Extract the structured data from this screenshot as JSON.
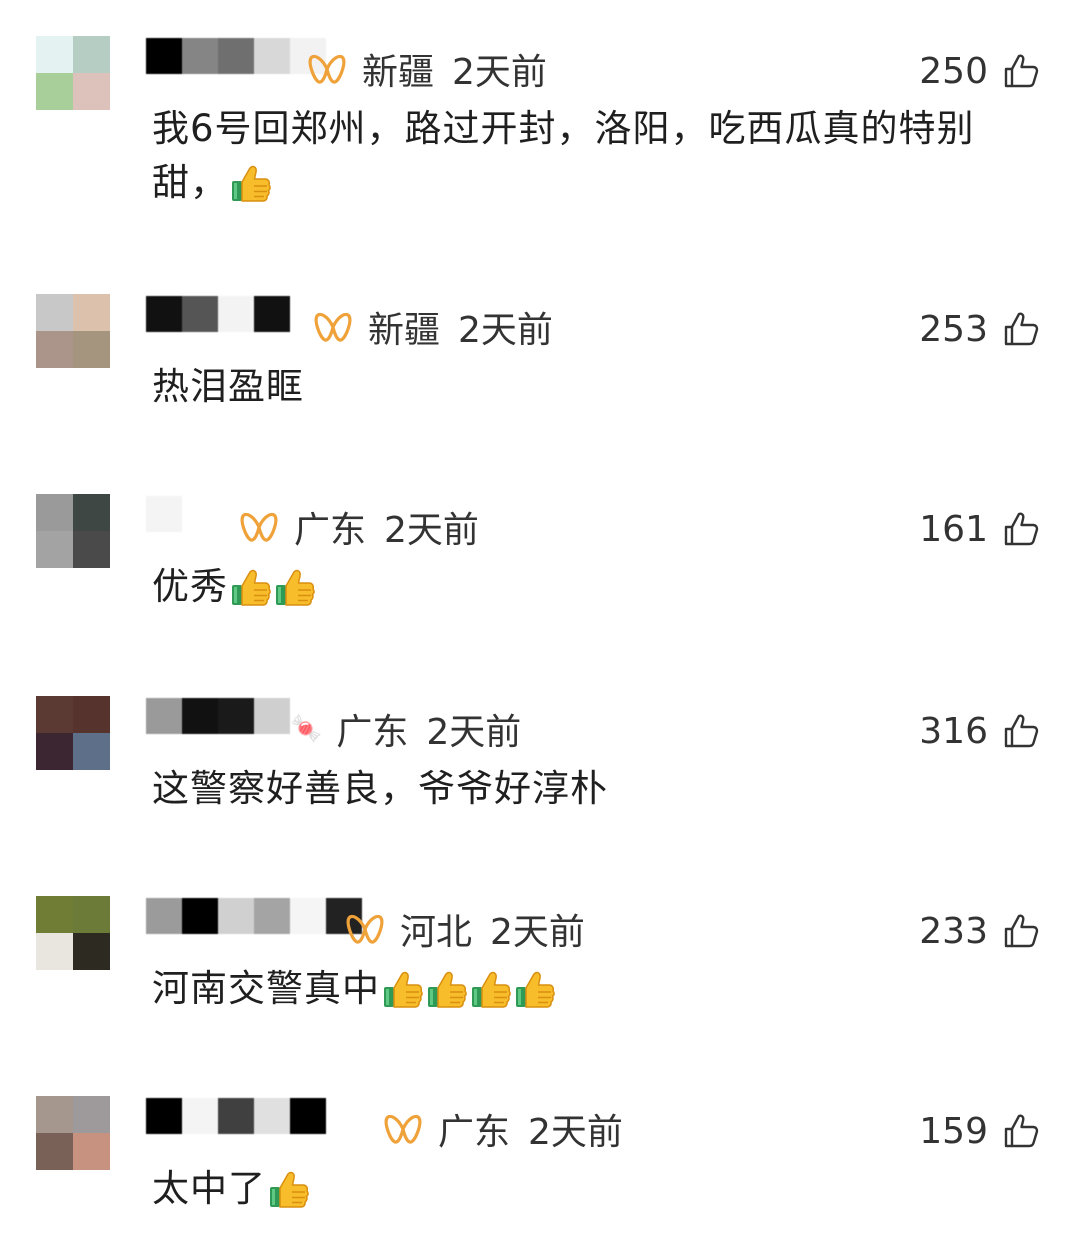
{
  "comments": [
    {
      "location": "新疆",
      "time": "2天前",
      "likes": "250",
      "text": "我6号回郑州，路过开封，洛阳，吃西瓜真的特别甜，",
      "emoji_count": 1,
      "badge": "gold-badge-icon",
      "avatar": [
        "#e4f2f2",
        "#b6cdc4",
        "#a8cf9a",
        "#dcc2bb"
      ],
      "name_blocks": [
        "#000000",
        "#858585",
        "#6f6f6f",
        "#d8d8d8",
        "#f2f2f2"
      ]
    },
    {
      "location": "新疆",
      "time": "2天前",
      "likes": "253",
      "text": "热泪盈眶",
      "emoji_count": 0,
      "badge": "gold-badge-icon",
      "avatar": [
        "#c8c8c8",
        "#dcc2ad",
        "#ab958b",
        "#a5957f"
      ],
      "name_blocks": [
        "#111111",
        "#555555",
        "#f3f3f3",
        "#111111"
      ]
    },
    {
      "location": "广东",
      "time": "2天前",
      "likes": "161",
      "text": "优秀",
      "emoji_count": 2,
      "badge": "gold-badge-icon",
      "avatar": [
        "#9a9a9a",
        "#3f4744",
        "#a3a3a3",
        "#4a4a4a"
      ],
      "name_blocks": [
        "#f4f4f4"
      ]
    },
    {
      "location": "广东",
      "time": "2天前",
      "likes": "316",
      "text": "这警察好善良，爷爷好淳朴",
      "emoji_count": 0,
      "badge": "candy-icon",
      "avatar": [
        "#5a3a32",
        "#56332c",
        "#3b2631",
        "#5e7089"
      ],
      "name_blocks": [
        "#9a9a9a",
        "#111111",
        "#1a1a1a",
        "#cfcfcf"
      ]
    },
    {
      "location": "河北",
      "time": "2天前",
      "likes": "233",
      "text": "河南交警真中",
      "emoji_count": 4,
      "badge": "gold-badge-icon",
      "avatar": [
        "#6f7d35",
        "#6c7b38",
        "#e9e6df",
        "#2d2a22"
      ],
      "name_blocks": [
        "#9b9b9b",
        "#000000",
        "#d0d0d0",
        "#a4a4a4",
        "#f5f5f5",
        "#222222"
      ]
    },
    {
      "location": "广东",
      "time": "2天前",
      "likes": "159",
      "text": "太中了",
      "emoji_count": 1,
      "badge": "gold-badge-icon",
      "avatar": [
        "#a5968e",
        "#9e9a9b",
        "#7a6157",
        "#c79280"
      ],
      "name_blocks": [
        "#000000",
        "#f4f4f4",
        "#404040",
        "#e0e0e0",
        "#000000"
      ]
    }
  ]
}
